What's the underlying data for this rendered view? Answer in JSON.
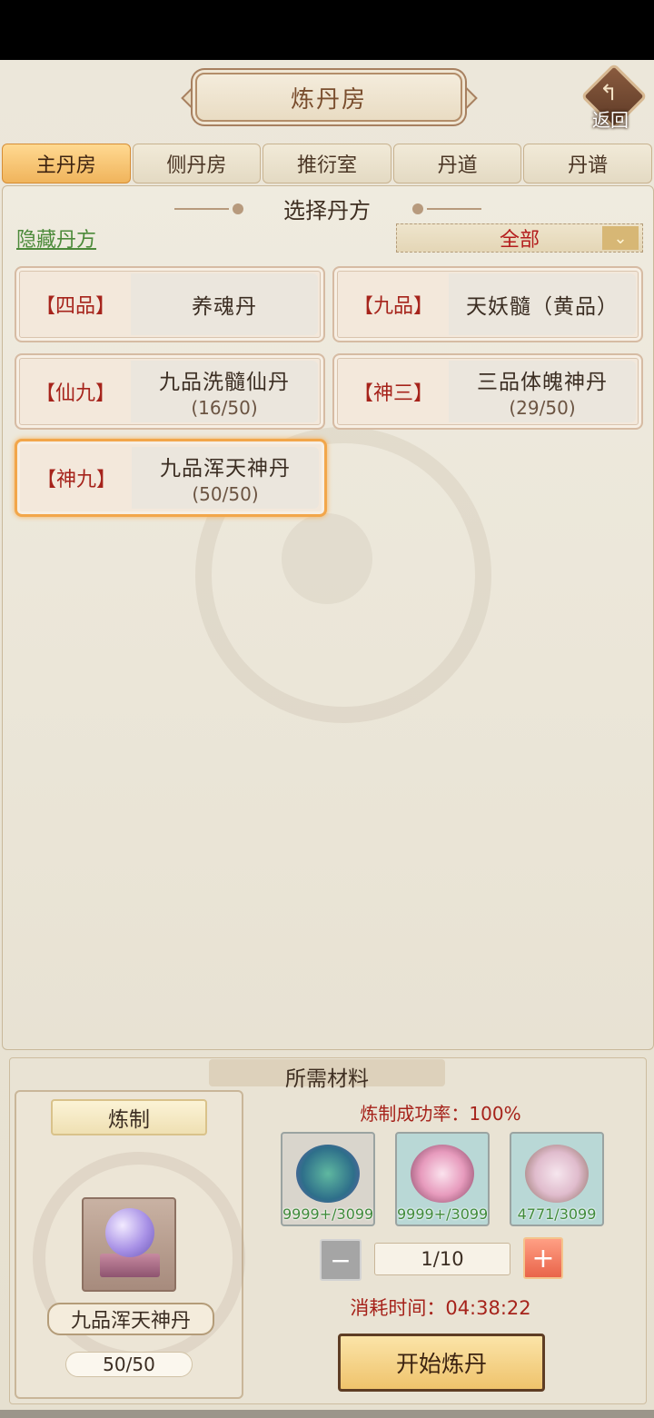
{
  "header": {
    "title": "炼丹房",
    "back_label": "返回"
  },
  "tabs": [
    {
      "label": "主丹房",
      "active": true
    },
    {
      "label": "侧丹房",
      "active": false
    },
    {
      "label": "推衍室",
      "active": false
    },
    {
      "label": "丹道",
      "active": false
    },
    {
      "label": "丹谱",
      "active": false
    }
  ],
  "section": {
    "title": "选择丹方",
    "hide_link": "隐藏丹方",
    "filter_value": "全部"
  },
  "recipes": [
    {
      "grade": "【四品】",
      "name": "养魂丹",
      "count": ""
    },
    {
      "grade": "【九品】",
      "name": "天妖髓（黄品）",
      "count": ""
    },
    {
      "grade": "【仙九】",
      "name": "九品洗髓仙丹",
      "count": "(16/50)"
    },
    {
      "grade": "【神三】",
      "name": "三品体魄神丹",
      "count": "(29/50)"
    },
    {
      "grade": "【神九】",
      "name": "九品浑天神丹",
      "count": "(50/50)",
      "selected": true
    }
  ],
  "materials_section": {
    "title": "所需材料",
    "craft_label": "炼制",
    "product_name": "九品浑天神丹",
    "product_count": "50/50",
    "success_rate": "炼制成功率：100%",
    "materials": [
      {
        "icon": "jade-tree-icon",
        "qty": "9999+/3099"
      },
      {
        "icon": "pink-flower-icon",
        "qty": "9999+/3099"
      },
      {
        "icon": "blossom-branch-icon",
        "qty": "4771/3099"
      }
    ],
    "quantity": "1/10",
    "time": "消耗时间：04:38:22",
    "start_button": "开始炼丹"
  }
}
